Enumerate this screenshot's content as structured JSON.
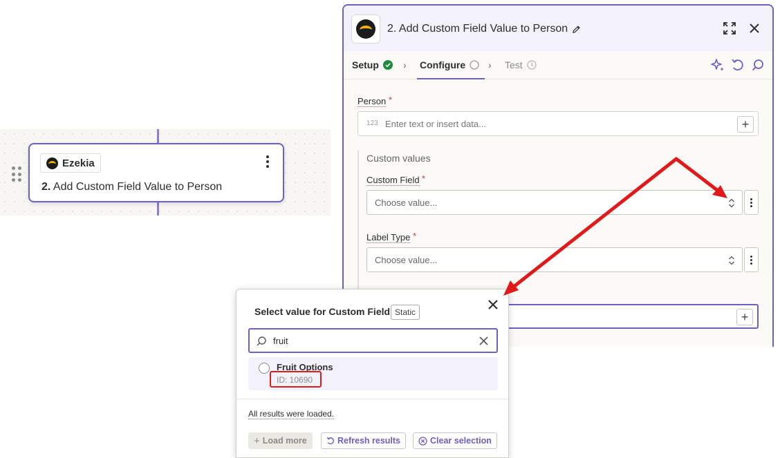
{
  "canvas": {
    "step_card": {
      "app_name": "Ezekia",
      "step_number": "2.",
      "step_title": "Add Custom Field Value to Person"
    }
  },
  "panel": {
    "title": "2. Add Custom Field Value to Person",
    "tabs": [
      {
        "label": "Setup",
        "status": "complete"
      },
      {
        "label": "Configure",
        "status": "active"
      },
      {
        "label": "Test",
        "status": "pending"
      }
    ],
    "person_field": {
      "label": "Person",
      "placeholder": "Enter text or insert data...",
      "type_hint": "123"
    },
    "custom_values": {
      "group_title": "Custom values",
      "custom_field": {
        "label": "Custom Field",
        "placeholder": "Choose value..."
      },
      "label_type": {
        "label": "Label Type",
        "placeholder": "Choose value..."
      }
    }
  },
  "popover": {
    "title": "Select value for Custom Field",
    "badge": "Static",
    "search_value": "fruit",
    "results": [
      {
        "name": "Fruit Options",
        "id_text": "ID: 10690"
      }
    ],
    "status_text": "All results were loaded.",
    "buttons": {
      "load_more": "Load more",
      "refresh": "Refresh results",
      "clear": "Clear selection"
    }
  },
  "colors": {
    "accent": "#6c5fc7",
    "annotation_red": "#e01a1a",
    "success": "#1e8a3c",
    "required": "#d0384b"
  }
}
